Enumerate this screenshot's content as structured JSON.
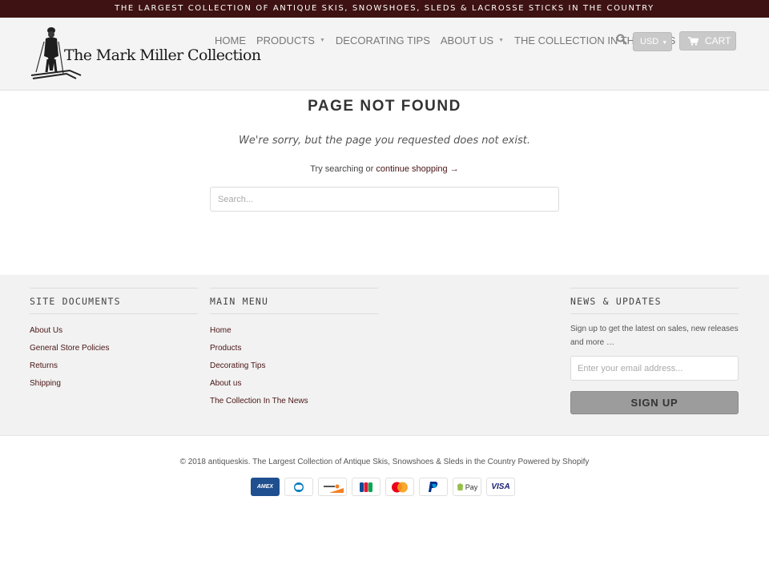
{
  "announcement": "THE LARGEST COLLECTION OF ANTIQUE SKIS, SNOWSHOES, SLEDS & LACROSSE STICKS IN THE COUNTRY",
  "logo": {
    "text": "The Mark Miller Collection",
    "icon": "skier-figure-icon"
  },
  "nav": {
    "items": [
      {
        "label": "HOME",
        "caret": false
      },
      {
        "label": "PRODUCTS",
        "caret": true
      },
      {
        "label": "DECORATING TIPS",
        "caret": false
      },
      {
        "label": "ABOUT US",
        "caret": true
      },
      {
        "label": "THE COLLECTION IN THE NEWS",
        "caret": false
      }
    ],
    "currency": "USD",
    "cart_label": "CART"
  },
  "not_found": {
    "title": "PAGE NOT FOUND",
    "message": "We're sorry, but the page you requested does not exist.",
    "try_prefix": "Try searching or",
    "continue_link": "continue shopping →",
    "search_placeholder": "Search..."
  },
  "footer": {
    "site_documents": {
      "heading": "SITE DOCUMENTS",
      "links": [
        "About Us",
        "General Store Policies",
        "Returns",
        "Shipping"
      ]
    },
    "main_menu": {
      "heading": "MAIN MENU",
      "links": [
        "Home",
        "Products",
        "Decorating Tips",
        "About us",
        "The Collection In The News"
      ]
    },
    "news": {
      "heading": "NEWS & UPDATES",
      "text": "Sign up to get the latest on sales, new releases and more …",
      "email_placeholder": "Enter your email address...",
      "button": "SIGN UP"
    }
  },
  "copyright": "© 2018 antiqueskis. The Largest Collection of Antique Skis, Snowshoes & Sleds in the Country Powered by Shopify",
  "payments": [
    "amex-icon",
    "diners-club-icon",
    "discover-icon",
    "jcb-icon",
    "mastercard-icon",
    "paypal-icon",
    "shopify-pay-icon",
    "visa-icon"
  ],
  "payment_labels": {
    "amex": "AMEX",
    "gpay": "Pay",
    "visa": "VISA"
  },
  "colors": {
    "topbar": "#3e1212",
    "link": "#4a1515",
    "button": "#9c9c9c"
  }
}
